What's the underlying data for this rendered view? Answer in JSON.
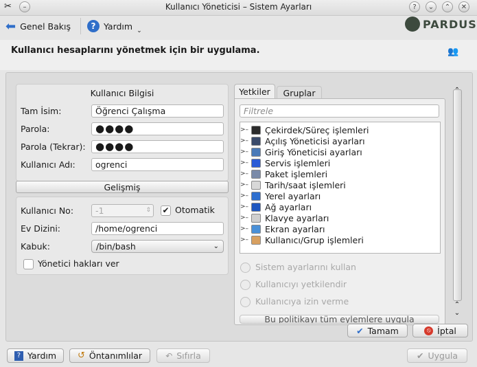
{
  "window": {
    "title": "Kullanıcı Yöneticisi – Sistem Ayarları"
  },
  "toolbar": {
    "overview": "Genel Bakış",
    "help": "Yardım",
    "brand": "PARDUS"
  },
  "header": {
    "description": "Kullanıcı hesaplarını yönetmek için bir uygulama."
  },
  "user_info": {
    "title": "Kullanıcı Bilgisi",
    "full_name_label": "Tam İsim:",
    "full_name": "Öğrenci Çalışma",
    "password_label": "Parola:",
    "password": "●●●●",
    "password2_label": "Parola (Tekrar):",
    "password2": "●●●●",
    "username_label": "Kullanıcı Adı:",
    "username": "ogrenci"
  },
  "advanced": {
    "title": "Gelişmiş",
    "uid_label": "Kullanıcı No:",
    "uid": "-1",
    "auto_label": "Otomatik",
    "auto_checked": true,
    "home_label": "Ev Dizini:",
    "home": "/home/ogrenci",
    "shell_label": "Kabuk:",
    "shell": "/bin/bash",
    "admin_label": "Yönetici hakları ver",
    "admin_checked": false
  },
  "tabs": [
    {
      "label": "Yetkiler",
      "active": true
    },
    {
      "label": "Gruplar",
      "active": false
    }
  ],
  "filter": {
    "placeholder": "Filtrele"
  },
  "permissions": [
    {
      "label": "Çekirdek/Süreç işlemleri",
      "icon": "terminal-icon",
      "color": "#2b2b2b"
    },
    {
      "label": "Açılış Yöneticisi ayarları",
      "icon": "floppy-icon",
      "color": "#3a4a6a"
    },
    {
      "label": "Giriş Yöneticisi ayarları",
      "icon": "login-icon",
      "color": "#4a7ab8"
    },
    {
      "label": "Servis işlemleri",
      "icon": "flag-icon",
      "color": "#2a5bd6"
    },
    {
      "label": "Paket işlemleri",
      "icon": "package-icon",
      "color": "#7a8aa8"
    },
    {
      "label": "Tarih/saat işlemleri",
      "icon": "clock-icon",
      "color": "#d8d8d8"
    },
    {
      "label": "Yerel ayarları",
      "icon": "locale-icon",
      "color": "#2f6fcf"
    },
    {
      "label": "Ağ ayarları",
      "icon": "network-icon",
      "color": "#1f57c0"
    },
    {
      "label": "Klavye ayarları",
      "icon": "keyboard-icon",
      "color": "#cfcfcf"
    },
    {
      "label": "Ekran ayarları",
      "icon": "monitor-icon",
      "color": "#4a90d8"
    },
    {
      "label": "Kullanıcı/Grup işlemleri",
      "icon": "users-icon",
      "color": "#d8a060"
    }
  ],
  "policy": {
    "option1": "Sistem ayarlarını kullan",
    "option2": "Kullanıcıyı yetkilendir",
    "option3": "Kullanıcıya izin verme",
    "partial_button": "Bu politikayı tüm eylemlere uygula"
  },
  "dialog_buttons": {
    "ok": "Tamam",
    "cancel": "İptal"
  },
  "bottom": {
    "help": "Yardım",
    "defaults": "Öntanımlılar",
    "reset": "Sıfırla",
    "apply": "Uygula"
  }
}
